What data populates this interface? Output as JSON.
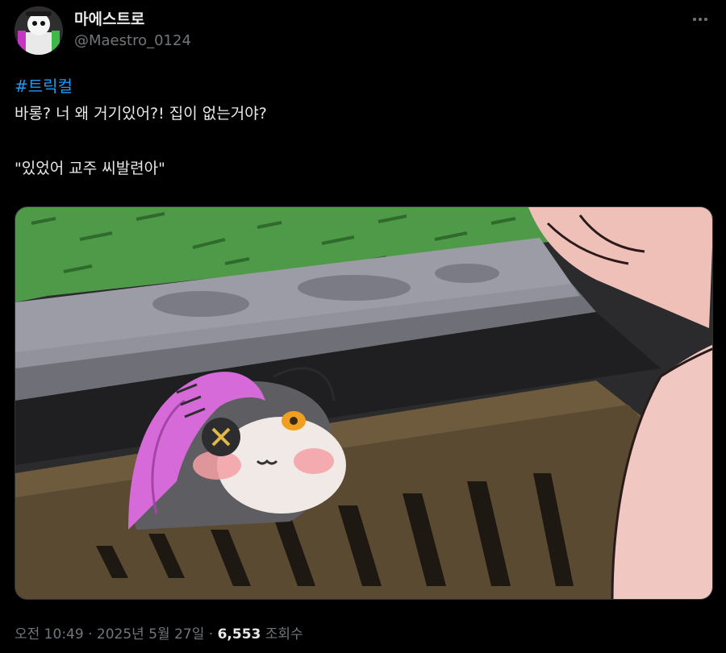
{
  "author": {
    "display_name": "마에스트로",
    "handle": "@Maestro_0124"
  },
  "tweet": {
    "hashtag": "#트릭컬",
    "line1": "바롱? 너 왜 거기있어?! 집이 없는거야?",
    "line2": "\"있었어 교주 씨발련아\""
  },
  "media": {
    "icon": "drawn-illustration"
  },
  "meta": {
    "time": "오전 10:49",
    "sep1": " · ",
    "date": "2025년 5월 27일",
    "sep2": " · ",
    "views": "6,553",
    "views_label": " 조회수"
  },
  "colors": {
    "background": "#000000",
    "text": "#e7e9ea",
    "muted": "#71767b",
    "link": "#1d9bf0"
  }
}
